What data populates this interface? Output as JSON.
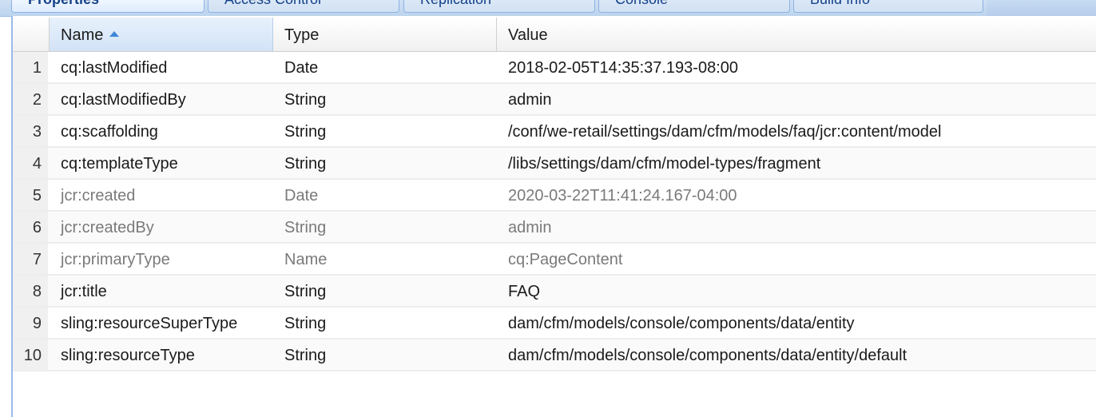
{
  "tabs": [
    {
      "label": "Properties",
      "active": true
    },
    {
      "label": "Access Control",
      "active": false
    },
    {
      "label": "Replication",
      "active": false
    },
    {
      "label": "Console",
      "active": false
    },
    {
      "label": "Build Info",
      "active": false
    }
  ],
  "grid": {
    "columns": {
      "name": "Name",
      "type": "Type",
      "value": "Value"
    },
    "sort": {
      "column": "Name",
      "direction": "ascending"
    },
    "rows": [
      {
        "index": "1",
        "name": "cq:lastModified",
        "type": "Date",
        "value": "2018-02-05T14:35:37.193-08:00",
        "protected": false
      },
      {
        "index": "2",
        "name": "cq:lastModifiedBy",
        "type": "String",
        "value": "admin",
        "protected": false
      },
      {
        "index": "3",
        "name": "cq:scaffolding",
        "type": "String",
        "value": "/conf/we-retail/settings/dam/cfm/models/faq/jcr:content/model",
        "protected": false
      },
      {
        "index": "4",
        "name": "cq:templateType",
        "type": "String",
        "value": "/libs/settings/dam/cfm/model-types/fragment",
        "protected": false
      },
      {
        "index": "5",
        "name": "jcr:created",
        "type": "Date",
        "value": "2020-03-22T11:41:24.167-04:00",
        "protected": true
      },
      {
        "index": "6",
        "name": "jcr:createdBy",
        "type": "String",
        "value": "admin",
        "protected": true
      },
      {
        "index": "7",
        "name": "jcr:primaryType",
        "type": "Name",
        "value": "cq:PageContent",
        "protected": true
      },
      {
        "index": "8",
        "name": "jcr:title",
        "type": "String",
        "value": "FAQ",
        "protected": false
      },
      {
        "index": "9",
        "name": "sling:resourceSuperType",
        "type": "String",
        "value": "dam/cfm/models/console/components/data/entity",
        "protected": false
      },
      {
        "index": "10",
        "name": "sling:resourceType",
        "type": "String",
        "value": "dam/cfm/models/console/components/data/entity/default",
        "protected": false
      }
    ]
  },
  "colors": {
    "tab_text": "#15428b",
    "sort_arrow": "#3f86d6",
    "protected_text": "#7a7a7a"
  }
}
